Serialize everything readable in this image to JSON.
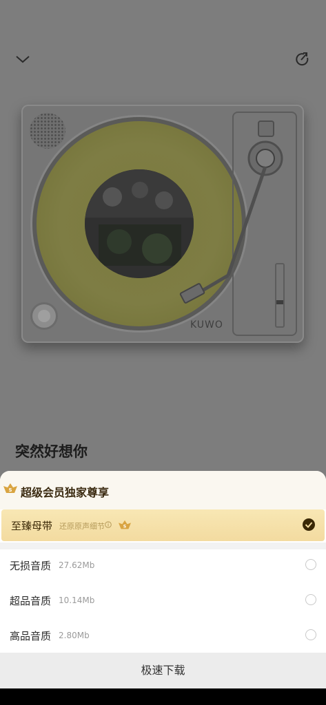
{
  "song": {
    "title": "突然好想你"
  },
  "turntable": {
    "brand": "KUWO"
  },
  "sheet": {
    "title": "超级会员独家尊享",
    "options": [
      {
        "name": "至臻母带",
        "desc": "还原原声细节",
        "selected": true
      },
      {
        "name": "无损音质",
        "size": "27.62Mb",
        "selected": false
      },
      {
        "name": "超品音质",
        "size": "10.14Mb",
        "selected": false
      },
      {
        "name": "高品音质",
        "size": "2.80Mb",
        "selected": false
      }
    ],
    "download_label": "极速下载"
  },
  "colors": {
    "accent_gold": "#f3dba0",
    "check": "#3a2806"
  },
  "icons": [
    "chevron-down-icon",
    "share-icon",
    "vip-badge-icon",
    "info-icon",
    "check-icon"
  ]
}
